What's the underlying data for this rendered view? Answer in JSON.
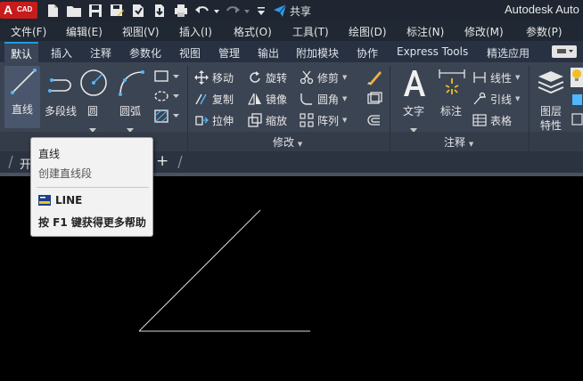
{
  "title_bar": {
    "logo_letter": "A",
    "logo_text": "CAD",
    "share_label": "共享",
    "app_title": "Autodesk Auto"
  },
  "menu": [
    "文件(F)",
    "编辑(E)",
    "视图(V)",
    "插入(I)",
    "格式(O)",
    "工具(T)",
    "绘图(D)",
    "标注(N)",
    "修改(M)",
    "参数(P)"
  ],
  "ribbon_tabs": [
    "默认",
    "插入",
    "注释",
    "参数化",
    "视图",
    "管理",
    "输出",
    "附加模块",
    "协作",
    "Express Tools",
    "精选应用"
  ],
  "active_tab": "默认",
  "draw_panel": {
    "line": "直线",
    "polyline": "多段线",
    "circle": "圆",
    "arc": "圆弧"
  },
  "modify_panel": {
    "title": "修改",
    "move": "移动",
    "rotate": "旋转",
    "trim": "修剪",
    "copy": "复制",
    "mirror": "镜像",
    "fillet": "圆角",
    "stretch": "拉伸",
    "scale": "缩放",
    "array": "阵列"
  },
  "annotation_panel": {
    "title": "注释",
    "text": "文字",
    "dimension": "标注",
    "linear": "线性",
    "leader": "引线",
    "table": "表格"
  },
  "layers_panel": {
    "layer_properties_line1": "图层",
    "layer_properties_line2": "特性"
  },
  "doc_tabs": {
    "start_tab": "开",
    "add": "+"
  },
  "tooltip": {
    "title": "直线",
    "description": "创建直线段",
    "command": "LINE",
    "help": "按 F1 键获得更多帮助"
  },
  "colors": {
    "accent": "#1d9be6",
    "logo_red": "#c81b1b",
    "ribbon_bg": "#3b4453",
    "canvas_bg": "#000000"
  }
}
